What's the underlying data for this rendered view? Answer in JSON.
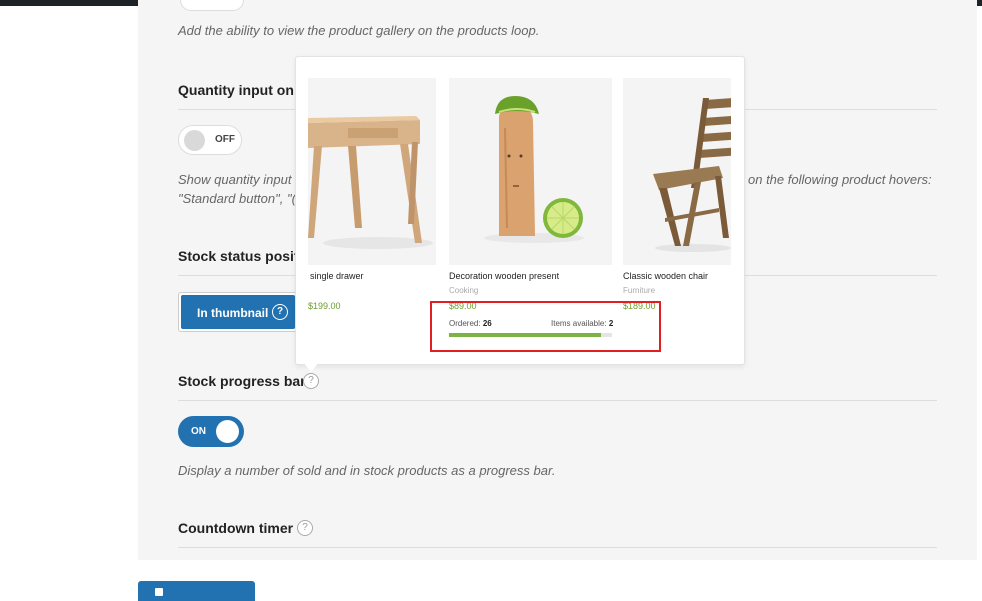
{
  "sections": {
    "gallery": {
      "description": "Add the ability to view the product gallery on the products loop."
    },
    "quantity": {
      "title": "Quantity input on",
      "toggle_label": "OFF",
      "description_start": "Show quantity input",
      "description_end": "on the following product hovers:",
      "description_line2": "\"Standard button\", \"("
    },
    "stock_status": {
      "title": "Stock status positi",
      "selected_option": "In thumbnail",
      "help": "?"
    },
    "stock_progress": {
      "title": "Stock progress bar",
      "help": "?",
      "toggle_label": "ON",
      "toggle_state": "on",
      "description": "Display a number of sold and in stock products as a progress bar."
    },
    "countdown": {
      "title": "Countdown timer",
      "help": "?"
    }
  },
  "preview": {
    "products": [
      {
        "title": "single drawer",
        "category": "",
        "price": "$199.00"
      },
      {
        "title": "Decoration wooden present",
        "category": "Cooking",
        "price": "$89.00"
      },
      {
        "title": "Classic wooden chair",
        "category": "Furniture",
        "price": "$189.00"
      }
    ],
    "stock": {
      "ordered_label": "Ordered:",
      "ordered_value": "26",
      "available_label": "Items available:",
      "available_value": "2",
      "progress_fraction": 0.93,
      "bar_color": "#7cb342"
    }
  },
  "colors": {
    "accent": "#2271b1",
    "price": "#6a9f2e",
    "highlight": "#e02020"
  }
}
